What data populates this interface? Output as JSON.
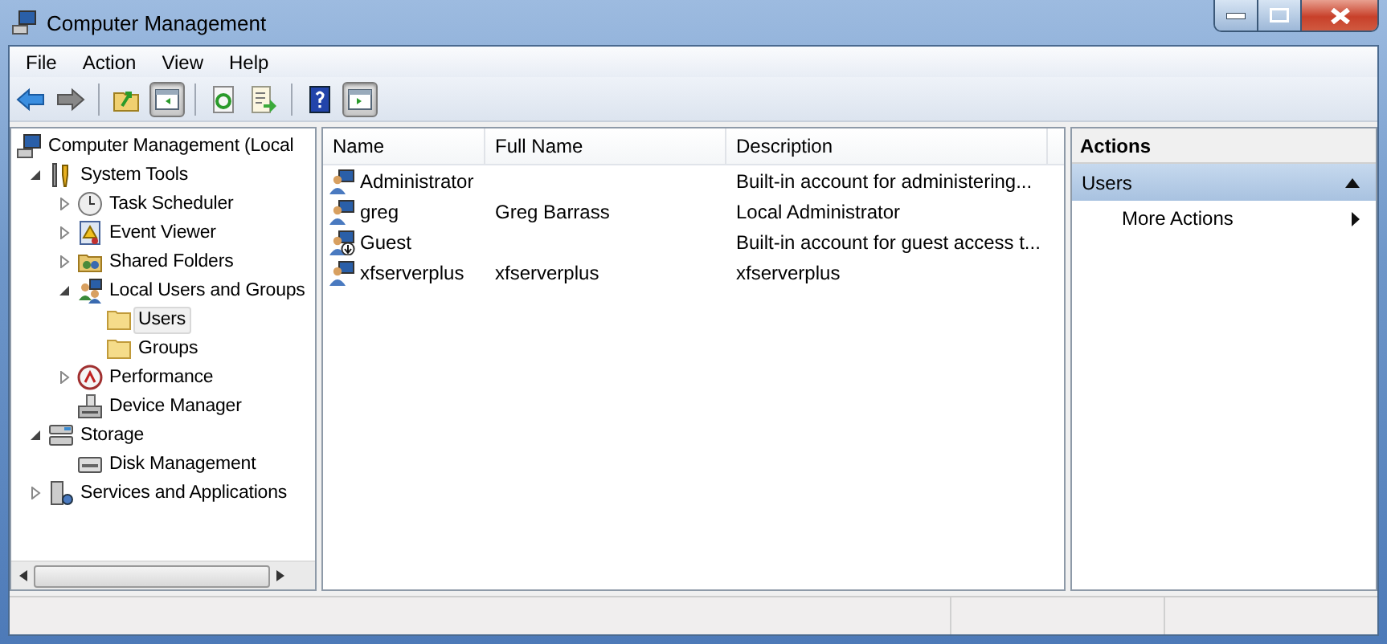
{
  "window": {
    "title": "Computer Management"
  },
  "menu": [
    "File",
    "Action",
    "View",
    "Help"
  ],
  "toolbar": [
    {
      "kind": "back",
      "on": false
    },
    {
      "kind": "forward",
      "on": false
    },
    {
      "kind": "sep"
    },
    {
      "kind": "up",
      "on": false
    },
    {
      "kind": "tree",
      "on": true
    },
    {
      "kind": "sep"
    },
    {
      "kind": "refresh",
      "on": false
    },
    {
      "kind": "export",
      "on": false
    },
    {
      "kind": "sep"
    },
    {
      "kind": "help",
      "on": false
    },
    {
      "kind": "actionpane",
      "on": true
    }
  ],
  "tree": [
    {
      "label": "Computer Management (Local",
      "kind": "computer",
      "selected": false,
      "children": [
        {
          "label": "System Tools",
          "kind": "tools",
          "expanded": true,
          "selected": false,
          "children": [
            {
              "label": "Task Scheduler",
              "kind": "clock",
              "expanded": false,
              "selected": false
            },
            {
              "label": "Event Viewer",
              "kind": "event",
              "expanded": false,
              "selected": false
            },
            {
              "label": "Shared Folders",
              "kind": "shared",
              "expanded": false,
              "selected": false
            },
            {
              "label": "Local Users and Groups",
              "kind": "users",
              "expanded": true,
              "selected": false,
              "children": [
                {
                  "label": "Users",
                  "kind": "folder",
                  "selected": true
                },
                {
                  "label": "Groups",
                  "kind": "folder",
                  "selected": false
                }
              ]
            },
            {
              "label": "Performance",
              "kind": "performance",
              "expanded": false,
              "selected": false
            },
            {
              "label": "Device Manager",
              "kind": "device",
              "selected": false
            }
          ]
        },
        {
          "label": "Storage",
          "kind": "storage",
          "expanded": true,
          "selected": false,
          "children": [
            {
              "label": "Disk Management",
              "kind": "disk",
              "selected": false
            }
          ]
        },
        {
          "label": "Services and Applications",
          "kind": "services",
          "expanded": false,
          "selected": false
        }
      ]
    }
  ],
  "table": {
    "columns": [
      "Name",
      "Full Name",
      "Description"
    ],
    "rows": [
      {
        "name": "Administrator",
        "full_name": "",
        "description": "Built-in account for administering...",
        "disabled": false
      },
      {
        "name": "greg",
        "full_name": "Greg Barrass",
        "description": "Local Administrator",
        "disabled": false
      },
      {
        "name": "Guest",
        "full_name": "",
        "description": "Built-in account for guest access t...",
        "disabled": true
      },
      {
        "name": "xfserverplus",
        "full_name": "xfserverplus",
        "description": "xfserverplus",
        "disabled": false
      }
    ]
  },
  "actions": {
    "title": "Actions",
    "sections": [
      {
        "label": "Users",
        "expanded": true,
        "items": [
          {
            "label": "More Actions",
            "submenu": true
          }
        ]
      }
    ]
  }
}
